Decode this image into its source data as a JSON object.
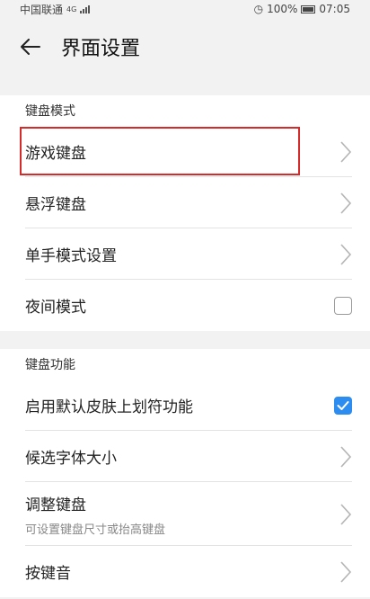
{
  "status_bar": {
    "carrier": "中国联通",
    "network": "4G",
    "battery": "100%",
    "time": "07:05"
  },
  "header": {
    "title": "界面设置"
  },
  "sections": [
    {
      "title": "键盘模式",
      "items": [
        {
          "label": "游戏键盘",
          "control": "chevron-right-icon"
        },
        {
          "label": "悬浮键盘",
          "control": "chevron-right-icon"
        },
        {
          "label": "单手模式设置",
          "control": "chevron-right-icon"
        },
        {
          "label": "夜间模式",
          "control": "checkbox",
          "checked": false
        }
      ]
    },
    {
      "title": "键盘功能",
      "items": [
        {
          "label": "启用默认皮肤上划符功能",
          "control": "checkbox",
          "checked": true
        },
        {
          "label": "候选字体大小",
          "control": "chevron-right-icon"
        },
        {
          "label": "调整键盘",
          "sublabel": "可设置键盘尺寸或抬高键盘",
          "control": "chevron-right-icon"
        },
        {
          "label": "按键音",
          "control": "chevron-right-icon"
        }
      ]
    }
  ],
  "colors": {
    "accent": "#2d8cf0",
    "highlight": "#d62b2b",
    "background": "#f2f2f2"
  }
}
